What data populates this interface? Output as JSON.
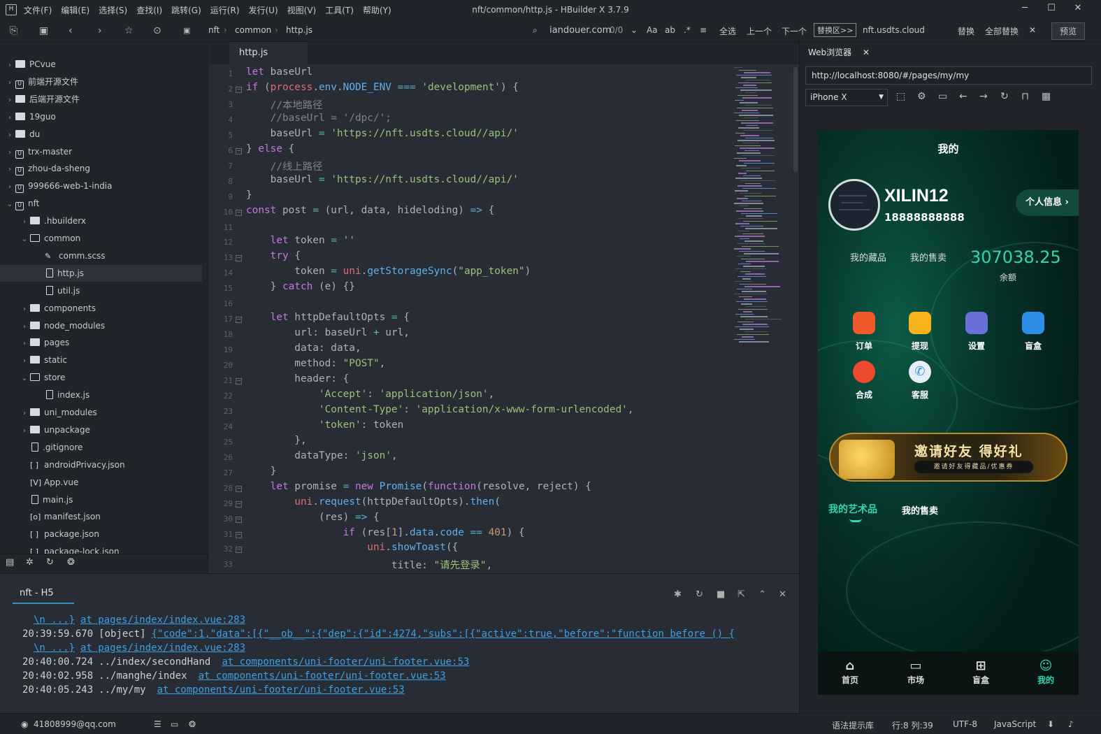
{
  "menu": [
    "文件(F)",
    "编辑(E)",
    "选择(S)",
    "查找(I)",
    "跳转(G)",
    "运行(R)",
    "发行(U)",
    "视图(V)",
    "工具(T)",
    "帮助(Y)"
  ],
  "window_title": "nft/common/http.js - HBuilder X 3.7.9",
  "toolbar": {
    "breadcrumb": [
      "nft",
      "common",
      "http.js"
    ],
    "search_value": "iandouer.com",
    "match_count": "0/0",
    "select_all": "全选",
    "prev": "上一个",
    "next": "下一个",
    "replace_scope": "替换区>>",
    "replace_value": "nft.usdts.cloud",
    "replace": "替换",
    "replace_all": "全部替换",
    "preview": "预览"
  },
  "tree": [
    {
      "label": "PCvue",
      "type": "proj-folder",
      "depth": 0,
      "expanded": false
    },
    {
      "label": "前端开源文件",
      "type": "proj",
      "depth": 0,
      "expanded": false
    },
    {
      "label": "后端开源文件",
      "type": "proj-folder",
      "depth": 0,
      "expanded": false
    },
    {
      "label": "19guo",
      "type": "proj-folder",
      "depth": 0,
      "expanded": false
    },
    {
      "label": "du",
      "type": "proj-folder",
      "depth": 0,
      "expanded": false
    },
    {
      "label": "trx-master",
      "type": "proj",
      "depth": 0,
      "expanded": false
    },
    {
      "label": "zhou-da-sheng",
      "type": "proj",
      "depth": 0,
      "expanded": false
    },
    {
      "label": "999666-web-1-india",
      "type": "proj",
      "depth": 0,
      "expanded": false
    },
    {
      "label": "nft",
      "type": "proj",
      "depth": 0,
      "expanded": true
    },
    {
      "label": ".hbuilderx",
      "type": "folder",
      "depth": 1,
      "expanded": false
    },
    {
      "label": "common",
      "type": "folder-open",
      "depth": 1,
      "expanded": true
    },
    {
      "label": "comm.scss",
      "type": "style",
      "depth": 2
    },
    {
      "label": "http.js",
      "type": "file",
      "depth": 2,
      "selected": true
    },
    {
      "label": "util.js",
      "type": "file",
      "depth": 2
    },
    {
      "label": "components",
      "type": "folder",
      "depth": 1,
      "expanded": false
    },
    {
      "label": "node_modules",
      "type": "folder",
      "depth": 1,
      "expanded": false
    },
    {
      "label": "pages",
      "type": "folder",
      "depth": 1,
      "expanded": false
    },
    {
      "label": "static",
      "type": "folder",
      "depth": 1,
      "expanded": false
    },
    {
      "label": "store",
      "type": "folder-open",
      "depth": 1,
      "expanded": true
    },
    {
      "label": "index.js",
      "type": "file",
      "depth": 2
    },
    {
      "label": "uni_modules",
      "type": "folder",
      "depth": 1,
      "expanded": false
    },
    {
      "label": "unpackage",
      "type": "folder",
      "depth": 1,
      "expanded": false
    },
    {
      "label": ".gitignore",
      "type": "file",
      "depth": 1
    },
    {
      "label": "androidPrivacy.json",
      "type": "json",
      "depth": 1
    },
    {
      "label": "App.vue",
      "type": "vue",
      "depth": 1
    },
    {
      "label": "main.js",
      "type": "file",
      "depth": 1
    },
    {
      "label": "manifest.json",
      "type": "manifest",
      "depth": 1
    },
    {
      "label": "package.json",
      "type": "json",
      "depth": 1
    },
    {
      "label": "package-lock.json",
      "type": "json",
      "depth": 1
    }
  ],
  "editor": {
    "tab": "http.js",
    "line_numbers": [
      "1",
      "2",
      "3",
      "4",
      "5",
      "6",
      "7",
      "8",
      "9",
      "10",
      "11",
      "12",
      "13",
      "14",
      "15",
      "16",
      "17",
      "18",
      "19",
      "20",
      "21",
      "22",
      "23",
      "24",
      "25",
      "26",
      "27",
      "28",
      "29",
      "30",
      "31",
      "32",
      "33"
    ],
    "fold_lines": [
      2,
      6,
      10,
      13,
      17,
      21,
      28,
      29,
      30,
      31,
      32
    ],
    "lines": [
      "let baseUrl",
      "if (process.env.NODE_ENV === 'development') {",
      "    //本地路径",
      "    //baseUrl = '/dpc/';",
      "    baseUrl = 'https://nft.usdts.cloud//api/'",
      "} else {",
      "    //线上路径",
      "    baseUrl = 'https://nft.usdts.cloud//api/'",
      "}",
      "const post = (url, data, hideloding) => {",
      "",
      "    let token = ''",
      "    try {",
      "        token = uni.getStorageSync(\"app_token\")",
      "    } catch (e) {}",
      "",
      "    let httpDefaultOpts = {",
      "        url: baseUrl + url,",
      "        data: data,",
      "        method: \"POST\",",
      "        header: {",
      "            'Accept': 'application/json',",
      "            'Content-Type': 'application/x-www-form-urlencoded',",
      "            'token': token",
      "        },",
      "        dataType: 'json',",
      "    }",
      "    let promise = new Promise(function(resolve, reject) {",
      "        uni.request(httpDefaultOpts).then(",
      "            (res) => {",
      "                if (res[1].data.code == 401) {",
      "                    uni.showToast({",
      "                        title: \"请先登录\","
    ]
  },
  "console": {
    "tab": "nft - H5",
    "lines": [
      {
        "time": "",
        "text": "",
        "link1": "\\n        ...}",
        "link2": "at pages/index/index.vue:283"
      },
      {
        "time": "20:39:59.670",
        "text": "[object]",
        "link1": "{\"code\":1,\"data\":[{\"__ob__\":{\"dep\":{\"id\":4274,\"subs\":[{\"active\":true,\"before\":\"function before () {",
        "link2": ""
      },
      {
        "time": "",
        "text": "",
        "link1": "\\n        ...}",
        "link2": "at pages/index/index.vue:283"
      },
      {
        "time": "20:40:00.724",
        "text": "../index/secondHand",
        "link1": "",
        "link2": "at components/uni-footer/uni-footer.vue:53"
      },
      {
        "time": "20:40:02.958",
        "text": "../manghe/index",
        "link1": "",
        "link2": "at components/uni-footer/uni-footer.vue:53"
      },
      {
        "time": "20:40:05.243",
        "text": "../my/my",
        "link1": "",
        "link2": "at components/uni-footer/uni-footer.vue:53"
      }
    ]
  },
  "browser": {
    "tab": "Web浏览器",
    "url": "http://localhost:8080/#/pages/my/my",
    "device": "iPhone X"
  },
  "phone": {
    "title": "我的",
    "username": "XILIN12",
    "phone": "18888888888",
    "info_button": "个人信息",
    "stat1": "我的藏品",
    "stat2": "我的售卖",
    "balance": "307038.25",
    "balance_label": "余额",
    "functions": [
      {
        "label": "订单",
        "color": "#f05a2a"
      },
      {
        "label": "提现",
        "color": "#f7b21c"
      },
      {
        "label": "设置",
        "color": "#6b6fd8"
      },
      {
        "label": "盲盒",
        "color": "#2f8fe8"
      },
      {
        "label": "合成",
        "color": "#ee4a2e"
      },
      {
        "label": "客服",
        "color": "#e8eef8"
      }
    ],
    "banner_title": "邀请好友 得好礼",
    "banner_sub": "邀请好友得藏品/优惠券",
    "tab_active": "我的艺术品",
    "tab_other": "我的售卖",
    "nav": [
      {
        "label": "首页",
        "icon": "home-icon"
      },
      {
        "label": "市场",
        "icon": "market-icon"
      },
      {
        "label": "盲盒",
        "icon": "gift-icon"
      },
      {
        "label": "我的",
        "icon": "user-icon",
        "active": true
      }
    ]
  },
  "status": {
    "account": "41808999@qq.com",
    "syntax": "语法提示库",
    "position": "行:8  列:39",
    "encoding": "UTF-8",
    "language": "JavaScript"
  }
}
